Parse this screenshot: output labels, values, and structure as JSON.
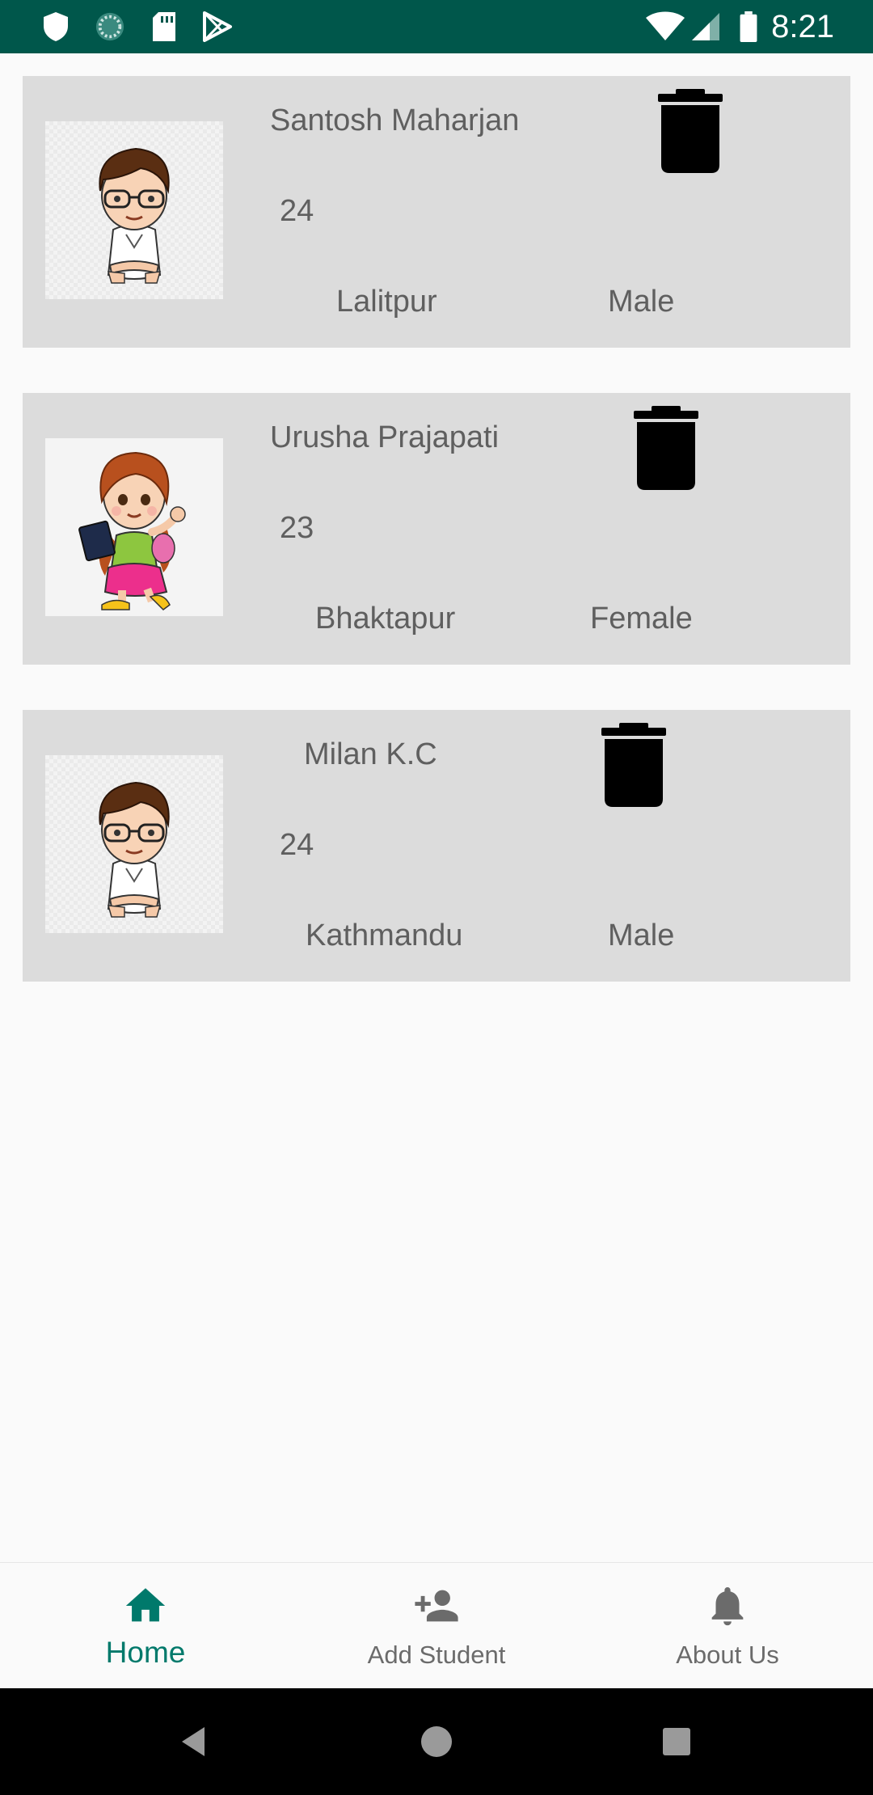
{
  "status_bar": {
    "time": "8:21",
    "icons": [
      "shield-icon",
      "sync-icon",
      "sd-card-icon",
      "play-store-icon",
      "wifi-icon",
      "signal-icon",
      "battery-icon"
    ]
  },
  "students": [
    {
      "name": "Santosh Maharjan",
      "age": "24",
      "address": "Lalitpur",
      "gender": "Male",
      "avatar": "boy-avatar"
    },
    {
      "name": "Urusha Prajapati",
      "age": "23",
      "address": "Bhaktapur",
      "gender": "Female",
      "avatar": "girl-avatar"
    },
    {
      "name": "Milan K.C",
      "age": "24",
      "address": "Kathmandu",
      "gender": "Male",
      "avatar": "boy-avatar"
    }
  ],
  "bottom_nav": {
    "items": [
      {
        "label": "Home",
        "icon": "home-icon",
        "active": true
      },
      {
        "label": "Add Student",
        "icon": "add-person-icon",
        "active": false
      },
      {
        "label": "About Us",
        "icon": "bell-icon",
        "active": false
      }
    ]
  },
  "colors": {
    "status_bar": "#00574b",
    "card_background": "#dcdcdc",
    "accent": "#00796b",
    "text": "#5f5f5f"
  },
  "system_nav": {
    "icons": [
      "back-icon",
      "home-circle-icon",
      "recents-icon"
    ]
  }
}
